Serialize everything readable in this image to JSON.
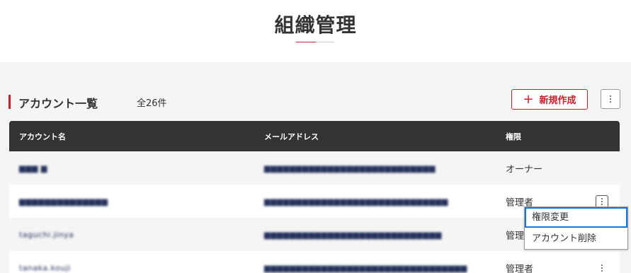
{
  "header": {
    "title": "組織管理"
  },
  "section": {
    "title": "アカウント一覧",
    "count": "全26件",
    "new_button_label": "新規作成",
    "new_button_icon": "plus-icon",
    "more_icon": "more-vertical-icon"
  },
  "table": {
    "columns": {
      "name": "アカウント名",
      "email": "メールアドレス",
      "role": "権限"
    },
    "rows": [
      {
        "name": "▆▆▆ ▆",
        "email": "▆▆▆▆▆▆▆▆▆▆▆▆▆▆▆▆▆▆▆▆▆▆▆▆▆▆▆",
        "role": "オーナー"
      },
      {
        "name": "▆▆▆▆▆▆▆▆▆▆▆▆▆▆",
        "email": "▆▆▆▆▆▆▆▆▆▆▆▆▆▆▆▆▆▆▆▆▆▆▆▆▆▆▆▆▆",
        "role": "管理者"
      },
      {
        "name": "taguchi.jinya",
        "email": "▆▆▆▆▆▆▆▆▆▆▆▆▆▆▆▆▆▆▆▆▆▆▆▆▆▆▆▆",
        "role": "管理者"
      },
      {
        "name": "tanaka.kouji",
        "email": "▆▆▆▆▆▆▆▆▆▆▆▆▆▆▆▆▆▆▆▆▆▆▆▆▆▆▆▆▆▆▆▆",
        "role": "管理者"
      }
    ]
  },
  "context_menu": {
    "items": [
      "権限変更",
      "アカウント削除"
    ]
  },
  "colors": {
    "accent": "#c7202a",
    "header_bg": "#333333",
    "focus": "#1e74d6"
  }
}
